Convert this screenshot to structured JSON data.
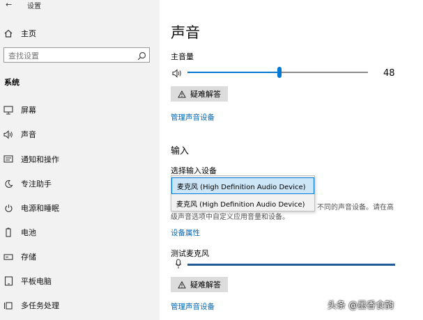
{
  "window": {
    "title": "设置"
  },
  "sidebar": {
    "home_label": "主页",
    "search_placeholder": "查找设置",
    "section_title": "系统",
    "items": [
      {
        "label": "屏幕",
        "icon": "monitor-icon"
      },
      {
        "label": "声音",
        "icon": "speaker-icon"
      },
      {
        "label": "通知和操作",
        "icon": "notification-icon"
      },
      {
        "label": "专注助手",
        "icon": "moon-icon"
      },
      {
        "label": "电源和睡眠",
        "icon": "power-icon"
      },
      {
        "label": "电池",
        "icon": "battery-icon"
      },
      {
        "label": "存储",
        "icon": "storage-icon"
      },
      {
        "label": "平板电脑",
        "icon": "tablet-icon"
      },
      {
        "label": "多任务处理",
        "icon": "multitask-icon"
      }
    ]
  },
  "main": {
    "title": "声音",
    "master_volume_label": "主音量",
    "volume_value": "48",
    "volume_fraction": 0.48,
    "troubleshoot_label": "疑难解答",
    "manage_devices_link": "管理声音设备",
    "input_heading": "输入",
    "choose_input_label": "选择输入设备",
    "input_options": [
      "麦克风 (High Definition Audio Device)",
      "麦克风 (High Definition Audio Device)"
    ],
    "description_line1": "不同的声音设备。请在高",
    "description_line2": "级声音选项中自定义应用音量和设备。",
    "device_properties_link": "设备属性",
    "test_mic_label": "测试麦克风",
    "troubleshoot_label_2": "疑难解答",
    "manage_devices_link_2": "管理声音设备"
  },
  "watermark": {
    "text": "头条 @墨香食韵"
  },
  "colors": {
    "accent": "#0078d7",
    "link": "#0066b4",
    "sidebar_bg": "#f2f2f2"
  }
}
